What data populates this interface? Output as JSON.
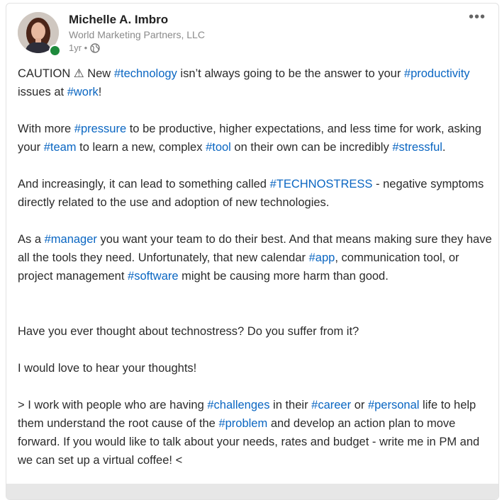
{
  "post": {
    "author_name": "Michelle A. Imbro",
    "company": "World Marketing Partners, LLC",
    "age": "1yr •",
    "more_label": "•••",
    "visibility_icon": "globe-icon",
    "presence_color": "#1e8a3c",
    "hashtag_color": "#0a66c2",
    "paragraphs": [
      [
        {
          "t": "CAUTION ⚠ New "
        },
        {
          "h": "#technology"
        },
        {
          "t": " isn’t always going to be the answer to your "
        },
        {
          "h": "#productivity"
        },
        {
          "t": " issues at "
        },
        {
          "h": "#work"
        },
        {
          "t": "!"
        }
      ],
      [
        {
          "t": "With more "
        },
        {
          "h": "#pressure"
        },
        {
          "t": " to be productive, higher expectations, and less time for work, asking your "
        },
        {
          "h": "#team"
        },
        {
          "t": " to learn a new, complex "
        },
        {
          "h": "#tool"
        },
        {
          "t": " on their own can be incredibly "
        },
        {
          "h": "#stressful"
        },
        {
          "t": "."
        }
      ],
      [
        {
          "t": "And increasingly, it can lead to something called "
        },
        {
          "h": "#TECHNOSTRESS"
        },
        {
          "t": " - negative symptoms directly related to the use and adoption of new technologies."
        }
      ],
      [
        {
          "t": "As a "
        },
        {
          "h": "#manager"
        },
        {
          "t": " you want your team to do their best. And that means making sure they have all the tools they need. Unfortunately, that new calendar "
        },
        {
          "h": "#app"
        },
        {
          "t": ", communication tool, or project management "
        },
        {
          "h": "#software"
        },
        {
          "t": " might be causing more harm than good."
        }
      ],
      [
        {
          "t": "Have you ever thought about technostress? Do you suffer from it?"
        }
      ],
      [
        {
          "t": "I would love to hear your thoughts!"
        }
      ],
      [
        {
          "t": "> I work with people who are having "
        },
        {
          "h": "#challenges"
        },
        {
          "t": " in their "
        },
        {
          "h": "#career"
        },
        {
          "t": " or "
        },
        {
          "h": "#personal"
        },
        {
          "t": " life to help them understand the root cause of the "
        },
        {
          "h": "#problem"
        },
        {
          "t": " and develop an action plan to move forward. If you would like to talk about your needs, rates and budget - write me in PM and we can set up a virtual coffee! <"
        }
      ]
    ]
  }
}
